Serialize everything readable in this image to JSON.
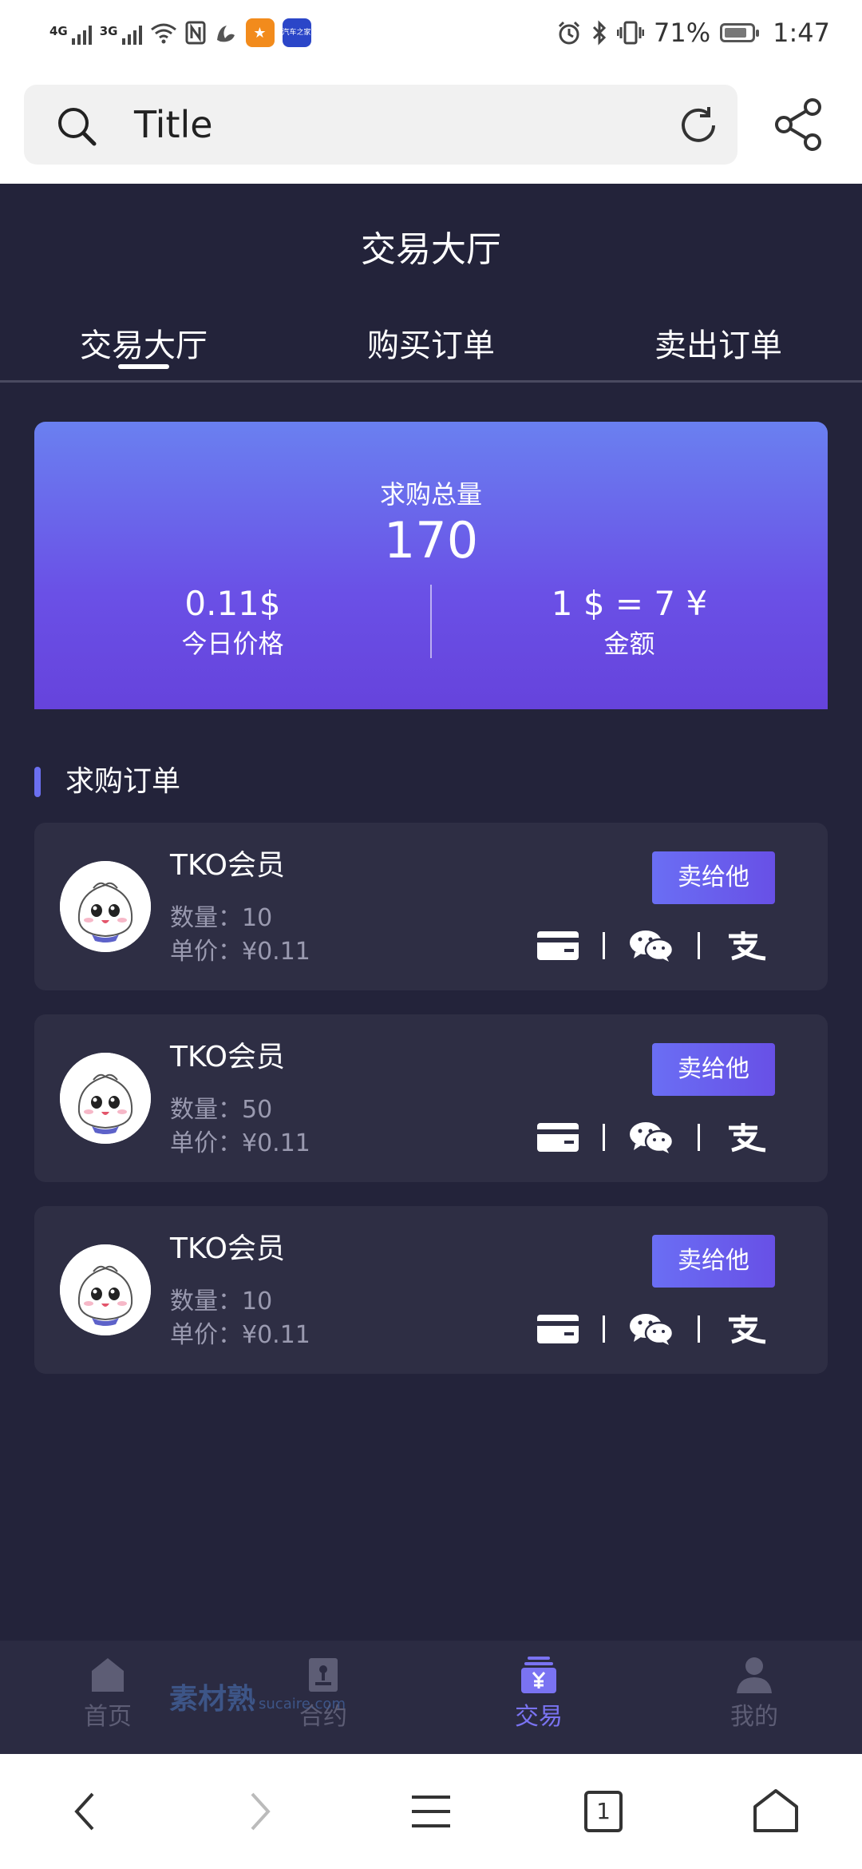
{
  "status_bar": {
    "net1": "4G",
    "net2": "3G",
    "battery": "71%",
    "time": "1:47",
    "app_icon_text": "汽车之家"
  },
  "browser": {
    "title": "Title"
  },
  "page": {
    "title": "交易大厅",
    "tabs": [
      "交易大厅",
      "购买订单",
      "卖出订单"
    ],
    "active_tab": 0
  },
  "summary": {
    "total_label": "求购总量",
    "total_value": "170",
    "price_value": "0.11$",
    "price_label": "今日价格",
    "rate_value": "1 $ = 7 ¥",
    "rate_label": "金额",
    "gradient": [
      "#6a80f0",
      "#6643dc"
    ]
  },
  "section": {
    "title": "求购订单"
  },
  "orders": [
    {
      "name": "TKO会员",
      "qty": "数量：10",
      "price": "单价：¥0.11",
      "button": "卖给他"
    },
    {
      "name": "TKO会员",
      "qty": "数量：50",
      "price": "单价：¥0.11",
      "button": "卖给他"
    },
    {
      "name": "TKO会员",
      "qty": "数量：10",
      "price": "单价：¥0.11",
      "button": "卖给他"
    }
  ],
  "payment_icons": [
    "bank-card-icon",
    "wechat-pay-icon",
    "alipay-icon"
  ],
  "bottom_nav": {
    "items": [
      {
        "label": "首页",
        "icon": "home-icon"
      },
      {
        "label": "合约",
        "icon": "contract-icon"
      },
      {
        "label": "交易",
        "icon": "trade-icon"
      },
      {
        "label": "我的",
        "icon": "profile-icon"
      }
    ],
    "active": 2,
    "active_color": "#7a73f2"
  },
  "watermark": {
    "text": "素材熟",
    "sub": "sucaire.com"
  },
  "system_nav": {
    "tab_count": "1"
  }
}
